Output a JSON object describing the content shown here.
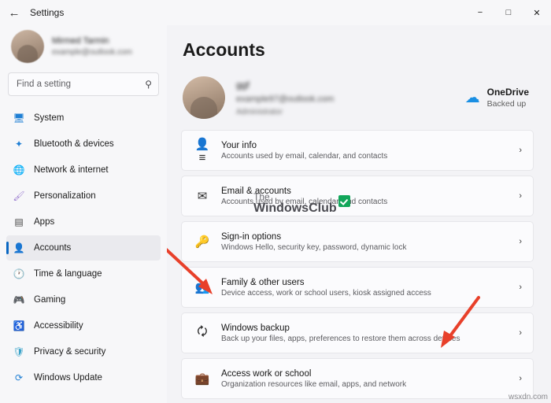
{
  "window": {
    "title": "Settings",
    "back_icon": "←",
    "controls": {
      "minimize": "−",
      "maximize": "□",
      "close": "✕"
    }
  },
  "sidebar": {
    "profile": {
      "name": "Mirmed Tarmin",
      "email": "example@outlook.com",
      "avatar_icon": "user-photo"
    },
    "search": {
      "placeholder": "Find a setting",
      "value": "",
      "icon": "search-icon"
    },
    "items": [
      {
        "label": "System",
        "icon": "🖥",
        "color": "#1f7fd4",
        "active": false
      },
      {
        "label": "Bluetooth & devices",
        "icon": "✦",
        "color": "#1f7fd4",
        "active": false
      },
      {
        "label": "Network & internet",
        "icon": "🌐",
        "color": "#1f7fd4",
        "active": false
      },
      {
        "label": "Personalization",
        "icon": "🖌",
        "color": "#9a7bd0",
        "active": false
      },
      {
        "label": "Apps",
        "icon": "▤",
        "color": "#444444",
        "active": false
      },
      {
        "label": "Accounts",
        "icon": "👤",
        "color": "#31a05e",
        "active": true
      },
      {
        "label": "Time & language",
        "icon": "🕐",
        "color": "#1f7fd4",
        "active": false
      },
      {
        "label": "Gaming",
        "icon": "🎮",
        "color": "#e05a3a",
        "active": false
      },
      {
        "label": "Accessibility",
        "icon": "♿",
        "color": "#1f7fd4",
        "active": false
      },
      {
        "label": "Privacy & security",
        "icon": "🛡",
        "color": "#3ba3c9",
        "active": false
      },
      {
        "label": "Windows Update",
        "icon": "⟳",
        "color": "#1f7fd4",
        "active": false
      }
    ]
  },
  "main": {
    "page_title": "Accounts",
    "account": {
      "name": "ggf",
      "email": "example97@outlook.com",
      "sub": "Administrator",
      "avatar_icon": "user-photo"
    },
    "onedrive": {
      "icon": "☁",
      "title": "OneDrive",
      "status": "Backed up"
    },
    "cards": [
      {
        "icon": "👤≡",
        "icon_name": "your-info-icon",
        "title": "Your info",
        "desc": "Accounts used by email, calendar, and contacts",
        "chevron": "›"
      },
      {
        "icon": "✉",
        "icon_name": "mail-icon",
        "title": "Email & accounts",
        "desc": "Accounts used by email, calendar, and contacts",
        "chevron": "›"
      },
      {
        "icon": "🔑",
        "icon_name": "key-icon",
        "title": "Sign-in options",
        "desc": "Windows Hello, security key, password, dynamic lock",
        "chevron": "›"
      },
      {
        "icon": "👥",
        "icon_name": "family-users-icon",
        "title": "Family & other users",
        "desc": "Device access, work or school users, kiosk assigned access",
        "chevron": "›"
      },
      {
        "icon": "🗘",
        "icon_name": "backup-icon",
        "title": "Windows backup",
        "desc": "Back up your files, apps, preferences to restore them across devices",
        "chevron": "›"
      },
      {
        "icon": "💼",
        "icon_name": "briefcase-icon",
        "title": "Access work or school",
        "desc": "Organization resources like email, apps, and network",
        "chevron": "›"
      }
    ]
  },
  "watermark": {
    "line1": "The",
    "line2": "WindowsClub",
    "corner": "wsxdn.com"
  },
  "annotations": {
    "arrow_color": "#e8402a",
    "arrow_count": 2
  }
}
